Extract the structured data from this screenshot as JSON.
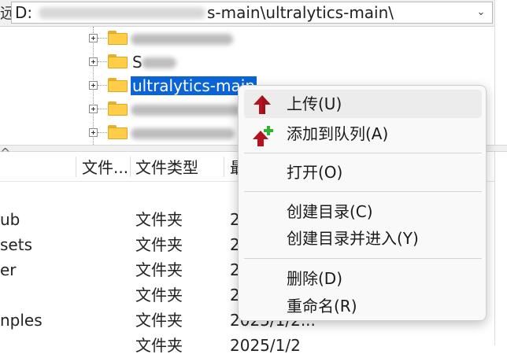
{
  "pathbar": {
    "prefix": "远",
    "drive": "D:",
    "path_tail": "s-main\\ultralytics-main\\",
    "dropdown_glyph": "⌄"
  },
  "tree": {
    "items": [
      {
        "label": "",
        "blurred": true
      },
      {
        "label": "S",
        "blurred": true
      },
      {
        "label": "ultralytics-main",
        "selected": true
      },
      {
        "label": "",
        "blurred": true
      },
      {
        "label": "",
        "blurred": true
      }
    ]
  },
  "filelist": {
    "columns": [
      "文件...",
      "文件类型",
      "最"
    ],
    "rows": [
      {
        "name": "ub",
        "type": "文件夹",
        "date": "2"
      },
      {
        "name": "sets",
        "type": "文件夹",
        "date": "2"
      },
      {
        "name": "er",
        "type": "文件夹",
        "date": "2"
      },
      {
        "name": "",
        "type": "文件夹",
        "date": "2"
      },
      {
        "name": "nples",
        "type": "文件夹",
        "date": "2025/1/2..."
      },
      {
        "name": "",
        "type": "文件夹",
        "date": "2025/1/2"
      }
    ]
  },
  "context_menu": {
    "items": [
      {
        "label": "上传(U)",
        "icon": "upload-arrow-icon"
      },
      {
        "label": "添加到队列(A)",
        "icon": "add-to-queue-icon"
      },
      {
        "label": "打开(O)"
      },
      {
        "label": "创建目录(C)"
      },
      {
        "label": "创建目录并进入(Y)"
      },
      {
        "label": "删除(D)"
      },
      {
        "label": "重命名(R)"
      }
    ]
  },
  "colors": {
    "selection": "#0a64d8",
    "folder": "#ffcd47",
    "upload_arrow": "#b3121e",
    "plus_green": "#2db52d"
  }
}
